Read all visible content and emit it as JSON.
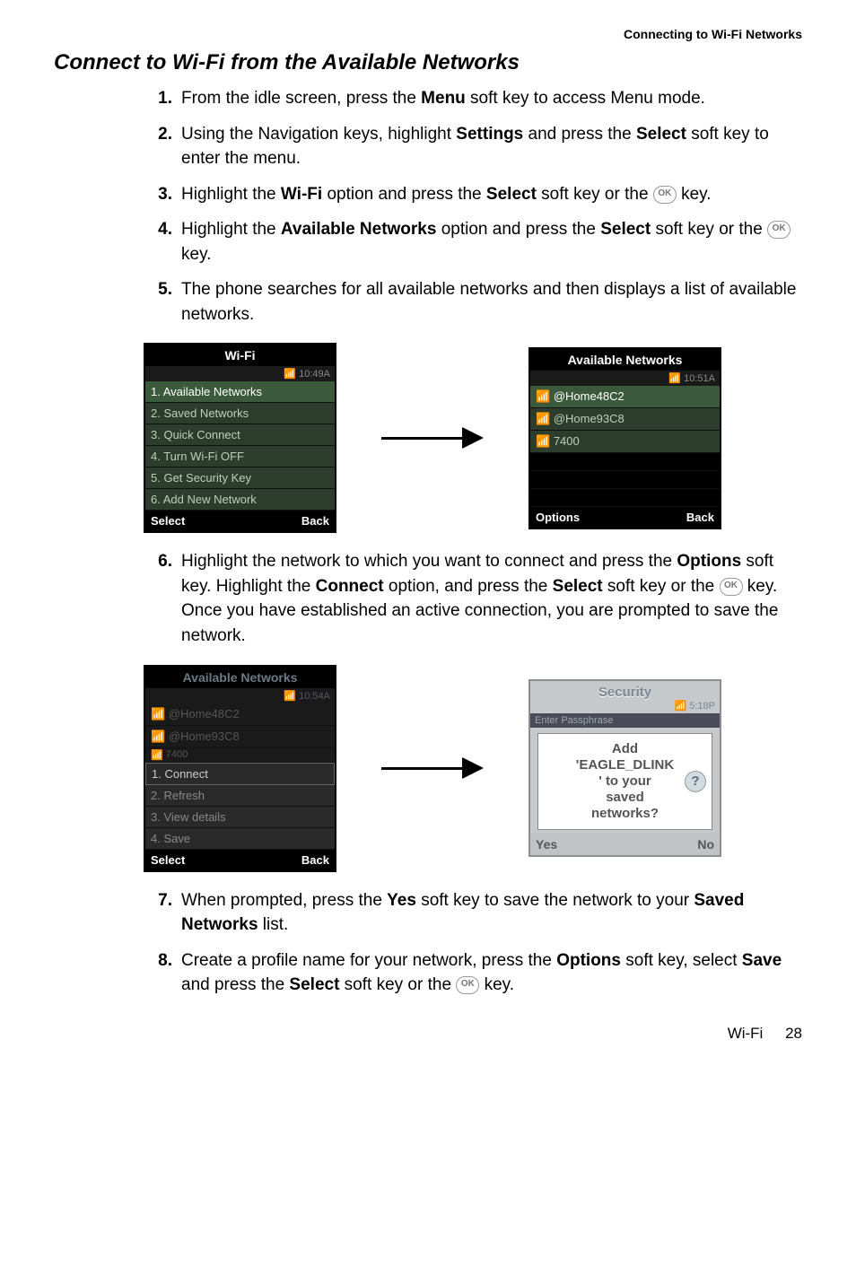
{
  "header": {
    "section": "Connecting to Wi-Fi Networks"
  },
  "title": "Connect to Wi-Fi from the Available Networks",
  "steps": {
    "s1": {
      "num": "1.",
      "pre": "From the idle screen, press the ",
      "b1": "Menu",
      "post": " soft key to access Menu mode."
    },
    "s2": {
      "num": "2.",
      "pre": "Using the Navigation keys, highlight ",
      "b1": "Settings",
      "mid": " and press the ",
      "b2": "Select",
      "post": " soft key to enter the menu."
    },
    "s3": {
      "num": "3.",
      "pre": "Highlight the ",
      "b1": "Wi-Fi",
      "mid": " option and press the ",
      "b2": "Select",
      "post1": " soft key or the ",
      "post2": " key."
    },
    "s4": {
      "num": "4.",
      "pre": "Highlight the ",
      "b1": "Available Networks",
      "mid": " option and press the ",
      "b2": "Select",
      "post1": " soft key or the ",
      "post2": " key."
    },
    "s5": {
      "num": "5.",
      "text": "The phone searches for all available networks and then displays a list of available networks."
    },
    "s6": {
      "num": "6.",
      "pre": "Highlight the network to which you want to connect and press the ",
      "b1": "Options",
      "mid1": " soft key. Highlight the ",
      "b2": "Connect",
      "mid2": " option, and press the ",
      "b3": "Select",
      "mid3": " soft key or the ",
      "post": " key. Once you have established an active connection, you are prompted to save the network."
    },
    "s7": {
      "num": "7.",
      "pre": "When prompted, press the ",
      "b1": "Yes",
      "mid": " soft key to save the network to your ",
      "b2": "Saved Networks",
      "post": " list."
    },
    "s8": {
      "num": "8.",
      "pre": "Create a profile name for your network, press the ",
      "b1": "Options",
      "mid1": " soft key, select ",
      "b2": "Save",
      "mid2": " and press the ",
      "b3": "Select",
      "mid3": " soft key or the ",
      "post": " key."
    }
  },
  "ok_label": "OK",
  "screen1": {
    "title": "Wi-Fi",
    "time": "10:49A",
    "items": [
      "1. Available Networks",
      "2. Saved Networks",
      "3. Quick Connect",
      "4. Turn Wi-Fi OFF",
      "5. Get Security Key",
      "6. Add New Network"
    ],
    "soft_left": "Select",
    "soft_right": "Back"
  },
  "screen2": {
    "title": "Available Networks",
    "time": "10:51A",
    "items": [
      "@Home48C2",
      "@Home93C8",
      "7400"
    ],
    "soft_left": "Options",
    "soft_right": "Back"
  },
  "screen3": {
    "title": "Available Networks",
    "time": "10:54A",
    "networks": [
      "@Home48C2",
      "@Home93C8",
      "7400"
    ],
    "menu": [
      "1.  Connect",
      "2.  Refresh",
      "3.  View details",
      "4.  Save"
    ],
    "soft_left": "Select",
    "soft_right": "Back"
  },
  "screen4": {
    "title": "Security",
    "time": "5:18P",
    "strip": "Enter Passphrase",
    "dialog": {
      "l1": "Add",
      "l2": "'EAGLE_DLINK",
      "l3": "' to your",
      "l4": "saved",
      "l5": "networks?",
      "help": "?"
    },
    "soft_left": "Yes",
    "soft_right": "No"
  },
  "footer": {
    "section": "Wi-Fi",
    "page": "28"
  }
}
